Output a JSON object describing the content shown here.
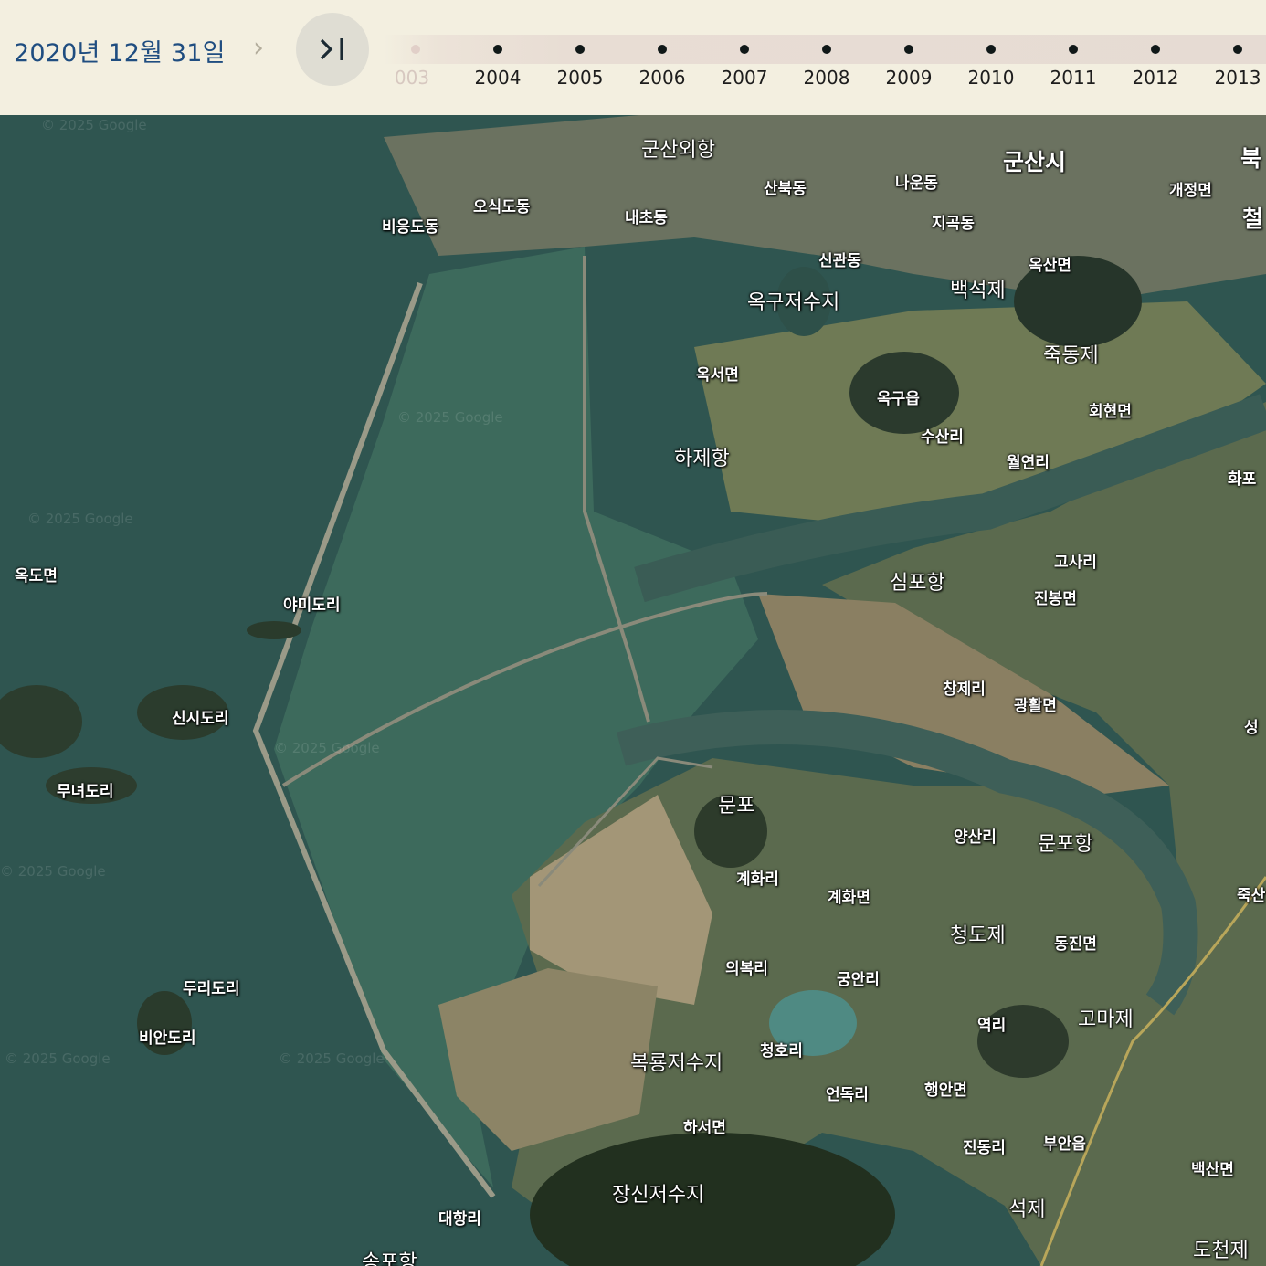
{
  "date_label": "2020년 12월 31일",
  "next_label": "›",
  "latest_icon": "skip-to-latest-icon",
  "timeline": {
    "years": [
      "003",
      "2004",
      "2005",
      "2006",
      "2007",
      "2008",
      "2009",
      "2010",
      "2011",
      "2012",
      "2013"
    ]
  },
  "watermark": "© 2025 Google",
  "place_labels": [
    "군산외항",
    "군산시",
    "북",
    "산북동",
    "나운동",
    "개정면",
    "오식도동",
    "내초동",
    "비응도동",
    "지곡동",
    "철",
    "신관동",
    "옥산면",
    "백석제",
    "옥구저수지",
    "죽동제",
    "옥서면",
    "옥구읍",
    "회현면",
    "수산리",
    "하제항",
    "월연리",
    "화포",
    "옥도면",
    "고사리",
    "심포항",
    "야미도리",
    "진봉면",
    "창제리",
    "광활면",
    "신시도리",
    "성",
    "무녀도리",
    "문포",
    "양산리",
    "문포항",
    "계화리",
    "계화면",
    "죽산",
    "청도제",
    "동진면",
    "의복리",
    "궁안리",
    "두리도리",
    "역리",
    "고마제",
    "비안도리",
    "청호리",
    "복룡저수지",
    "행안면",
    "언독리",
    "하서면",
    "진동리",
    "부안읍",
    "백산면",
    "장신저수지",
    "석제",
    "대항리",
    "도천제",
    "송포항"
  ]
}
